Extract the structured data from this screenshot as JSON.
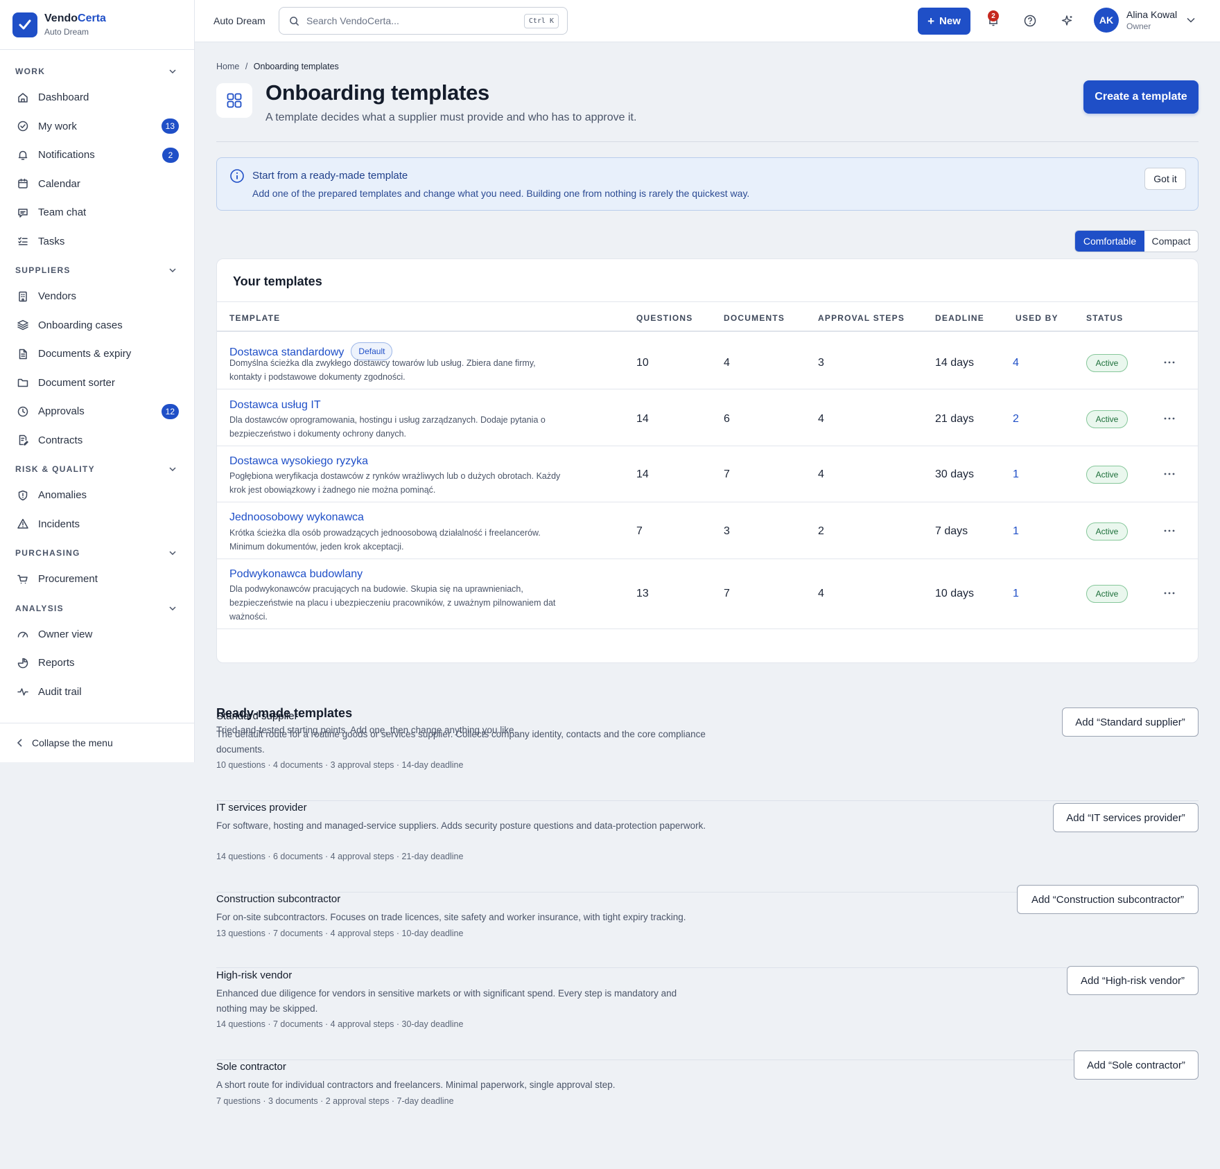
{
  "brand": {
    "name_a": "Vendo",
    "name_b": "Certa",
    "org": "Auto Dream"
  },
  "nav": [
    {
      "group": "WORK",
      "items": [
        {
          "label": "Dashboard",
          "icon": "home-icon",
          "badge": ""
        },
        {
          "label": "My work",
          "icon": "check-circle-icon",
          "badge": "13"
        },
        {
          "label": "Notifications",
          "icon": "bell-icon",
          "badge": "2"
        },
        {
          "label": "Calendar",
          "icon": "calendar-icon",
          "badge": ""
        },
        {
          "label": "Team chat",
          "icon": "chat-icon",
          "badge": ""
        },
        {
          "label": "Tasks",
          "icon": "list-check-icon",
          "badge": ""
        }
      ]
    },
    {
      "group": "SUPPLIERS",
      "items": [
        {
          "label": "Vendors",
          "icon": "building-icon",
          "badge": ""
        },
        {
          "label": "Onboarding cases",
          "icon": "layers-icon",
          "badge": ""
        },
        {
          "label": "Documents & expiry",
          "icon": "document-icon",
          "badge": ""
        },
        {
          "label": "Document sorter",
          "icon": "folder-icon",
          "badge": ""
        },
        {
          "label": "Approvals",
          "icon": "clock-icon",
          "badge": "12"
        },
        {
          "label": "Contracts",
          "icon": "contract-icon",
          "badge": ""
        }
      ]
    },
    {
      "group": "RISK & QUALITY",
      "items": [
        {
          "label": "Anomalies",
          "icon": "shield-icon",
          "badge": ""
        },
        {
          "label": "Incidents",
          "icon": "warning-icon",
          "badge": ""
        }
      ]
    },
    {
      "group": "PURCHASING",
      "items": [
        {
          "label": "Procurement",
          "icon": "cart-icon",
          "badge": ""
        }
      ]
    },
    {
      "group": "ANALYSIS",
      "items": [
        {
          "label": "Owner view",
          "icon": "gauge-icon",
          "badge": ""
        },
        {
          "label": "Reports",
          "icon": "pie-icon",
          "badge": ""
        },
        {
          "label": "Audit trail",
          "icon": "activity-icon",
          "badge": ""
        }
      ]
    }
  ],
  "collapse_label": "Collapse the menu",
  "topbar": {
    "org": "Auto Dream",
    "search_placeholder": "Search VendoCerta...",
    "search_shortcut": "Ctrl K",
    "new_label": "New",
    "notif_count": "2",
    "user_initials": "AK",
    "user_name": "Alina Kowal",
    "user_role": "Owner"
  },
  "page": {
    "crumb_home": "Home",
    "crumb_sep": "/",
    "crumb_current": "Onboarding templates",
    "title": "Onboarding templates",
    "subtitle": "A template decides what a supplier must provide and who has to approve it.",
    "create_label": "Create a template"
  },
  "info": {
    "title": "Start from a ready-made template",
    "text": "Add one of the prepared templates and change what you need. Building one from nothing is rarely the quickest way.",
    "dismiss": "Got it"
  },
  "density": {
    "on": "Comfortable",
    "off": "Compact"
  },
  "table": {
    "title": "Your templates",
    "columns": [
      "TEMPLATE",
      "QUESTIONS",
      "DOCUMENTS",
      "APPROVAL STEPS",
      "DEADLINE",
      "USED BY",
      "STATUS"
    ],
    "rows": [
      {
        "name": "Dostawca standardowy",
        "badge": "Default",
        "desc": "Domyślna ścieżka dla zwykłego dostawcy towarów lub usług. Zbiera dane firmy, kontakty i podstawowe dokumenty zgodności.",
        "questions": "10",
        "documents": "4",
        "steps": "3",
        "deadline": "14 days",
        "used_by": "4",
        "status": "Active"
      },
      {
        "name": "Dostawca usług IT",
        "badge": "",
        "desc": "Dla dostawców oprogramowania, hostingu i usług zarządzanych. Dodaje pytania o bezpieczeństwo i dokumenty ochrony danych.",
        "questions": "14",
        "documents": "6",
        "steps": "4",
        "deadline": "21 days",
        "used_by": "2",
        "status": "Active"
      },
      {
        "name": "Dostawca wysokiego ryzyka",
        "badge": "",
        "desc": "Pogłębiona weryfikacja dostawców z rynków wrażliwych lub o dużych obrotach. Każdy krok jest obowiązkowy i żadnego nie można pominąć.",
        "questions": "14",
        "documents": "7",
        "steps": "4",
        "deadline": "30 days",
        "used_by": "1",
        "status": "Active"
      },
      {
        "name": "Jednoosobowy wykonawca",
        "badge": "",
        "desc": "Krótka ścieżka dla osób prowadzących jednoosobową działalność i freelancerów. Minimum dokumentów, jeden krok akceptacji.",
        "questions": "7",
        "documents": "3",
        "steps": "2",
        "deadline": "7 days",
        "used_by": "1",
        "status": "Active"
      },
      {
        "name": "Podwykonawca budowlany",
        "badge": "",
        "desc": "Dla podwykonawców pracujących na budowie. Skupia się na uprawnieniach, bezpieczeństwie na placu i ubezpieczeniu pracowników, z uważnym pilnowaniem dat ważności.",
        "questions": "13",
        "documents": "7",
        "steps": "4",
        "deadline": "10 days",
        "used_by": "1",
        "status": "Active"
      }
    ]
  },
  "ready": {
    "title": "Ready-made templates",
    "subtitle": "Tried-and-tested starting points. Add one, then change anything you like.",
    "items": [
      {
        "name": "Standard supplier",
        "desc": "The default route for a routine goods or services supplier. Collects company identity, contacts and the core compliance documents.",
        "stats": "10 questions · 4 documents · 3 approval steps · 14-day deadline",
        "button": "Add “Standard supplier”"
      },
      {
        "name": "IT services provider",
        "desc": "For software, hosting and managed-service suppliers. Adds security posture questions and data-protection paperwork.",
        "stats": "14 questions · 6 documents · 4 approval steps · 21-day deadline",
        "button": "Add “IT services provider”"
      },
      {
        "name": "Construction subcontractor",
        "desc": "For on-site subcontractors. Focuses on trade licences, site safety and worker insurance, with tight expiry tracking.",
        "stats": "13 questions · 7 documents · 4 approval steps · 10-day deadline",
        "button": "Add “Construction subcontractor”"
      },
      {
        "name": "High-risk vendor",
        "desc": "Enhanced due diligence for vendors in sensitive markets or with significant spend. Every step is mandatory and nothing may be skipped.",
        "stats": "14 questions · 7 documents · 4 approval steps · 30-day deadline",
        "button": "Add “High-risk vendor”"
      },
      {
        "name": "Sole contractor",
        "desc": "A short route for individual contractors and freelancers. Minimal paperwork, single approval step.",
        "stats": "7 questions · 3 documents · 2 approval steps · 7-day deadline",
        "button": "Add “Sole contractor”"
      }
    ]
  },
  "colors": {
    "accent": "#1f4fc7",
    "status_active": "#1d6f3a",
    "alert": "#c6281f"
  }
}
